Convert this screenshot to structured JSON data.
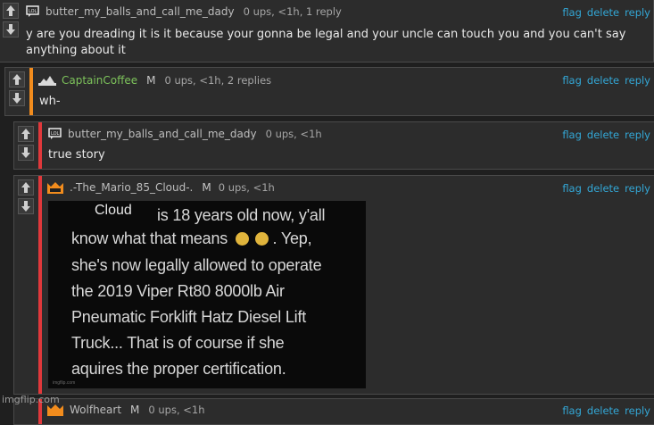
{
  "actions": {
    "flag": "flag",
    "delete": "delete",
    "reply": "reply"
  },
  "comments": [
    {
      "username": "butter_my_balls_and_call_me_dady",
      "mod": "",
      "meta": "0 ups, <1h, 1 reply",
      "text": "y are you dreading it is it because your gonna be legal and your uncle can touch you and you can't say anything about it",
      "bar_color": ""
    },
    {
      "username": "CaptainCoffee",
      "mod": "M",
      "meta": "0 ups, <1h, 2 replies",
      "text": "wh-",
      "bar_color": "#f28c1d"
    },
    {
      "username": "butter_my_balls_and_call_me_dady",
      "mod": "",
      "meta": "0 ups, <1h",
      "text": "true story",
      "bar_color": "#e0383b"
    },
    {
      "username": ".-The_Mario_85_Cloud-.",
      "mod": "M",
      "meta": "0 ups, <1h",
      "text": "",
      "bar_color": "#e0383b"
    },
    {
      "username": "Wolfheart",
      "mod": "M",
      "meta": "0 ups, <1h",
      "text": "",
      "bar_color": ""
    }
  ],
  "meme": {
    "cloud_label": "Cloud",
    "lines": [
      "is 18 years old now, y'all",
      "know what that means",
      "she's now legally allowed to operate",
      "the 2019 Viper Rt80 8000lb Air",
      "Pneumatic Forklift Hatz Diesel Lift",
      "Truck... That is of course if she",
      "aquires the proper certification."
    ],
    "yep": ". Yep,",
    "watermark": "imgflip.com"
  },
  "imgflip_watermark": "imgflip.com",
  "icons": {
    "upvote": "arrow-up-icon",
    "downvote": "arrow-down-icon",
    "user1": "lol-flag-icon",
    "user2": "mountain-icon",
    "user4": "crown-icon"
  },
  "colors": {
    "link": "#33a7d6",
    "username_green": "#7dc35b",
    "orange_bar": "#f28c1d",
    "red_bar": "#e0383b"
  }
}
